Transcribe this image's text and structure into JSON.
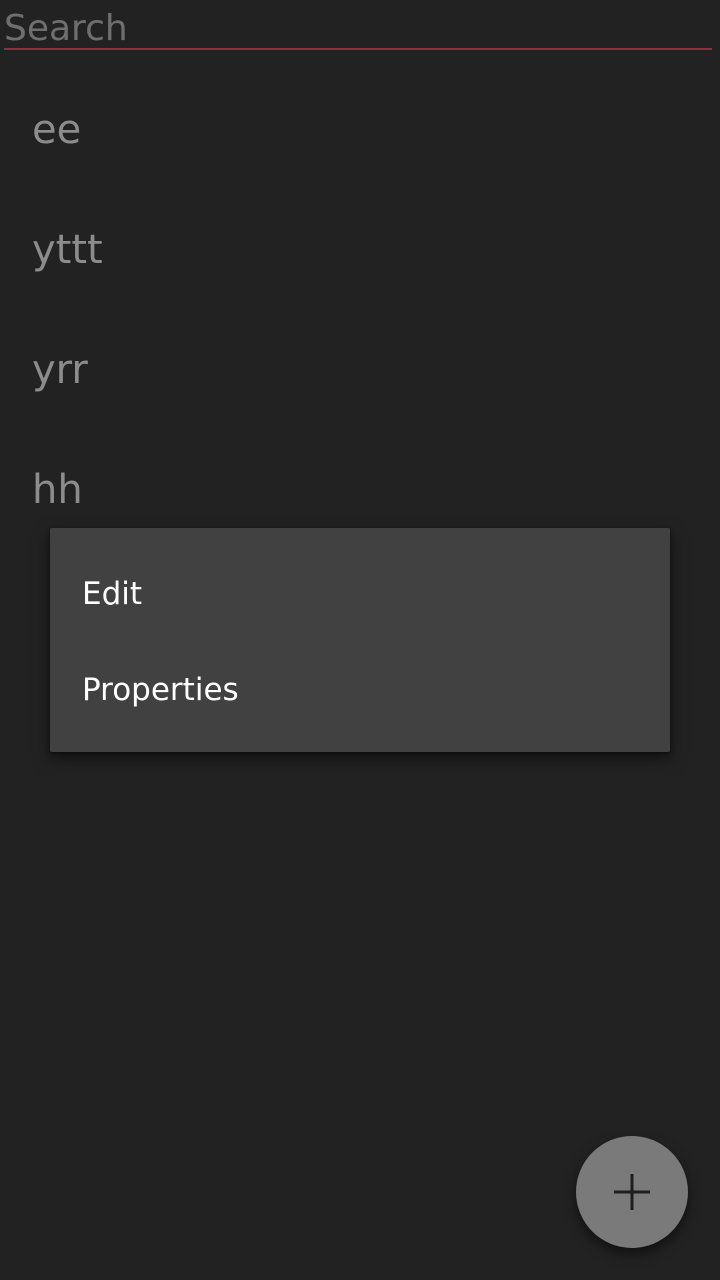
{
  "search": {
    "placeholder": "Search",
    "value": ""
  },
  "notes": [
    {
      "title": "ee"
    },
    {
      "title": "yttt"
    },
    {
      "title": "yrr"
    },
    {
      "title": "hh"
    }
  ],
  "context_menu": {
    "items": [
      {
        "label": "Edit"
      },
      {
        "label": "Properties"
      }
    ]
  },
  "fab": {
    "icon": "plus-icon"
  },
  "colors": {
    "background": "#222222",
    "menu_background": "#414141",
    "search_underline": "#8a3040",
    "fab_background": "#7a7a7a",
    "note_text": "#8c8c8c"
  }
}
